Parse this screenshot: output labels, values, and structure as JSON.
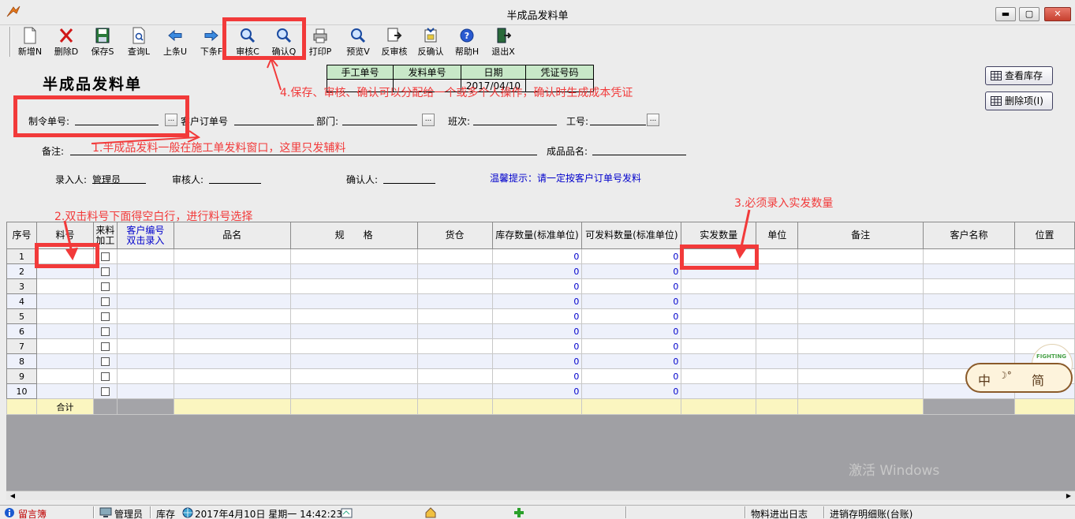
{
  "window": {
    "title": "半成品发料单",
    "minimize": "▬",
    "maximize": "▢",
    "close": "✕"
  },
  "toolbar": {
    "new": "新增N",
    "delete": "删除D",
    "save": "保存S",
    "query": "查询L",
    "prev": "上条U",
    "next": "下条F",
    "audit": "审核C",
    "confirm": "确认Q",
    "print": "打印P",
    "preview": "预览V",
    "unaudit": "反审核",
    "unconfirm": "反确认",
    "help": "帮助H",
    "exit": "退出X"
  },
  "form": {
    "title": "半成品发料单",
    "voucher_headers": [
      "手工单号",
      "发料单号",
      "日期",
      "凭证号码"
    ],
    "voucher_values": [
      "",
      "",
      "2017/04/10",
      ""
    ],
    "order_no_label": "制令单号:",
    "customer_order_label": "客户订单号",
    "dept_label": "部门:",
    "shift_label": "班次:",
    "emp_no_label": "工号:",
    "remark_label": "备注:",
    "product_name_label": "成品品名:",
    "entered_by_label": "录入人:",
    "entered_by_value": "管理员",
    "auditor_label": "审核人:",
    "confirmer_label": "确认人:",
    "hint": "温馨提示：请一定按客户订单号发料",
    "ellipsis": "..."
  },
  "side_buttons": {
    "view_stock": "查看库存",
    "delete_item": "删除项(I)"
  },
  "annotations": {
    "a1": "1.半成品发料一般在施工单发料窗口，这里只发辅料",
    "a2": "2.双击料号下面得空白行，进行料号选择",
    "a3": "3.必须录入实发数量",
    "a4": "4.保存、审核、确认可以分配给一个或多个人操作，确认时生成成本凭证"
  },
  "grid": {
    "columns": [
      "序号",
      "料号",
      "来料加工",
      "客户编号双击录入",
      "品名",
      "规　　格",
      "货仓",
      "库存数量(标准单位)",
      "可发料数量(标准单位)",
      "实发数量",
      "单位",
      "备注",
      "客户名称",
      "位置"
    ],
    "col_customer_line1": "客户编号",
    "col_customer_line2": "双击录入",
    "col_incoming_line1": "来料",
    "col_incoming_line2": "加工",
    "rows": [
      {
        "no": "1",
        "stock": "0",
        "avail": "0"
      },
      {
        "no": "2",
        "stock": "0",
        "avail": "0"
      },
      {
        "no": "3",
        "stock": "0",
        "avail": "0"
      },
      {
        "no": "4",
        "stock": "0",
        "avail": "0"
      },
      {
        "no": "5",
        "stock": "0",
        "avail": "0"
      },
      {
        "no": "6",
        "stock": "0",
        "avail": "0"
      },
      {
        "no": "7",
        "stock": "0",
        "avail": "0"
      },
      {
        "no": "8",
        "stock": "0",
        "avail": "0"
      },
      {
        "no": "9",
        "stock": "0",
        "avail": "0"
      },
      {
        "no": "10",
        "stock": "0",
        "avail": "0"
      }
    ],
    "total_label": "合计"
  },
  "ime": {
    "lang": "中",
    "mode": "简",
    "tag": "FIGHTING"
  },
  "watermark": "激活 Windows",
  "statusbar": {
    "guestbook": "留言簿",
    "user": "管理员",
    "module": "库存",
    "datetime": "2017年4月10日 星期一 14:42:23",
    "log": "物料进出日志",
    "detail": "进销存明细账(台账)"
  }
}
